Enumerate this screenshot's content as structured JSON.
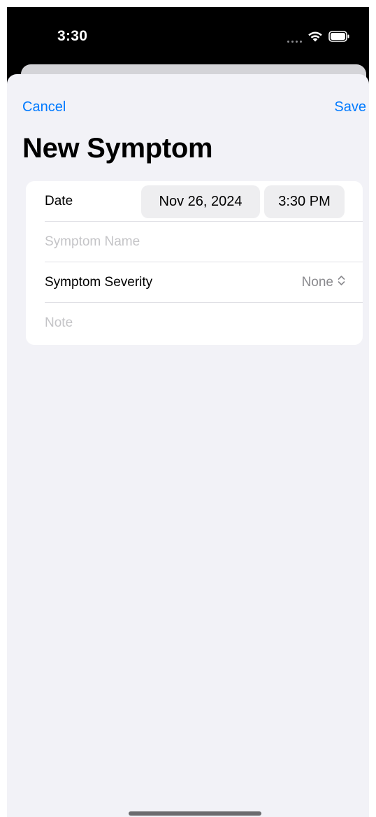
{
  "status_bar": {
    "time": "3:30"
  },
  "nav": {
    "cancel_label": "Cancel",
    "save_label": "Save"
  },
  "page": {
    "title": "New Symptom"
  },
  "form": {
    "date_label": "Date",
    "date_value": "Nov 26, 2024",
    "time_value": "3:30 PM",
    "symptom_name_placeholder": "Symptom Name",
    "severity_label": "Symptom Severity",
    "severity_value": "None",
    "note_placeholder": "Note"
  },
  "colors": {
    "accent": "#007aff",
    "sheet_background": "#f2f2f7",
    "card_background": "#ffffff",
    "placeholder": "#c4c4c7"
  },
  "icons": {
    "wifi": "wifi-icon",
    "battery": "battery-icon",
    "signal": "signal-icon",
    "severity_chevron": "chevron-up-down-icon"
  }
}
